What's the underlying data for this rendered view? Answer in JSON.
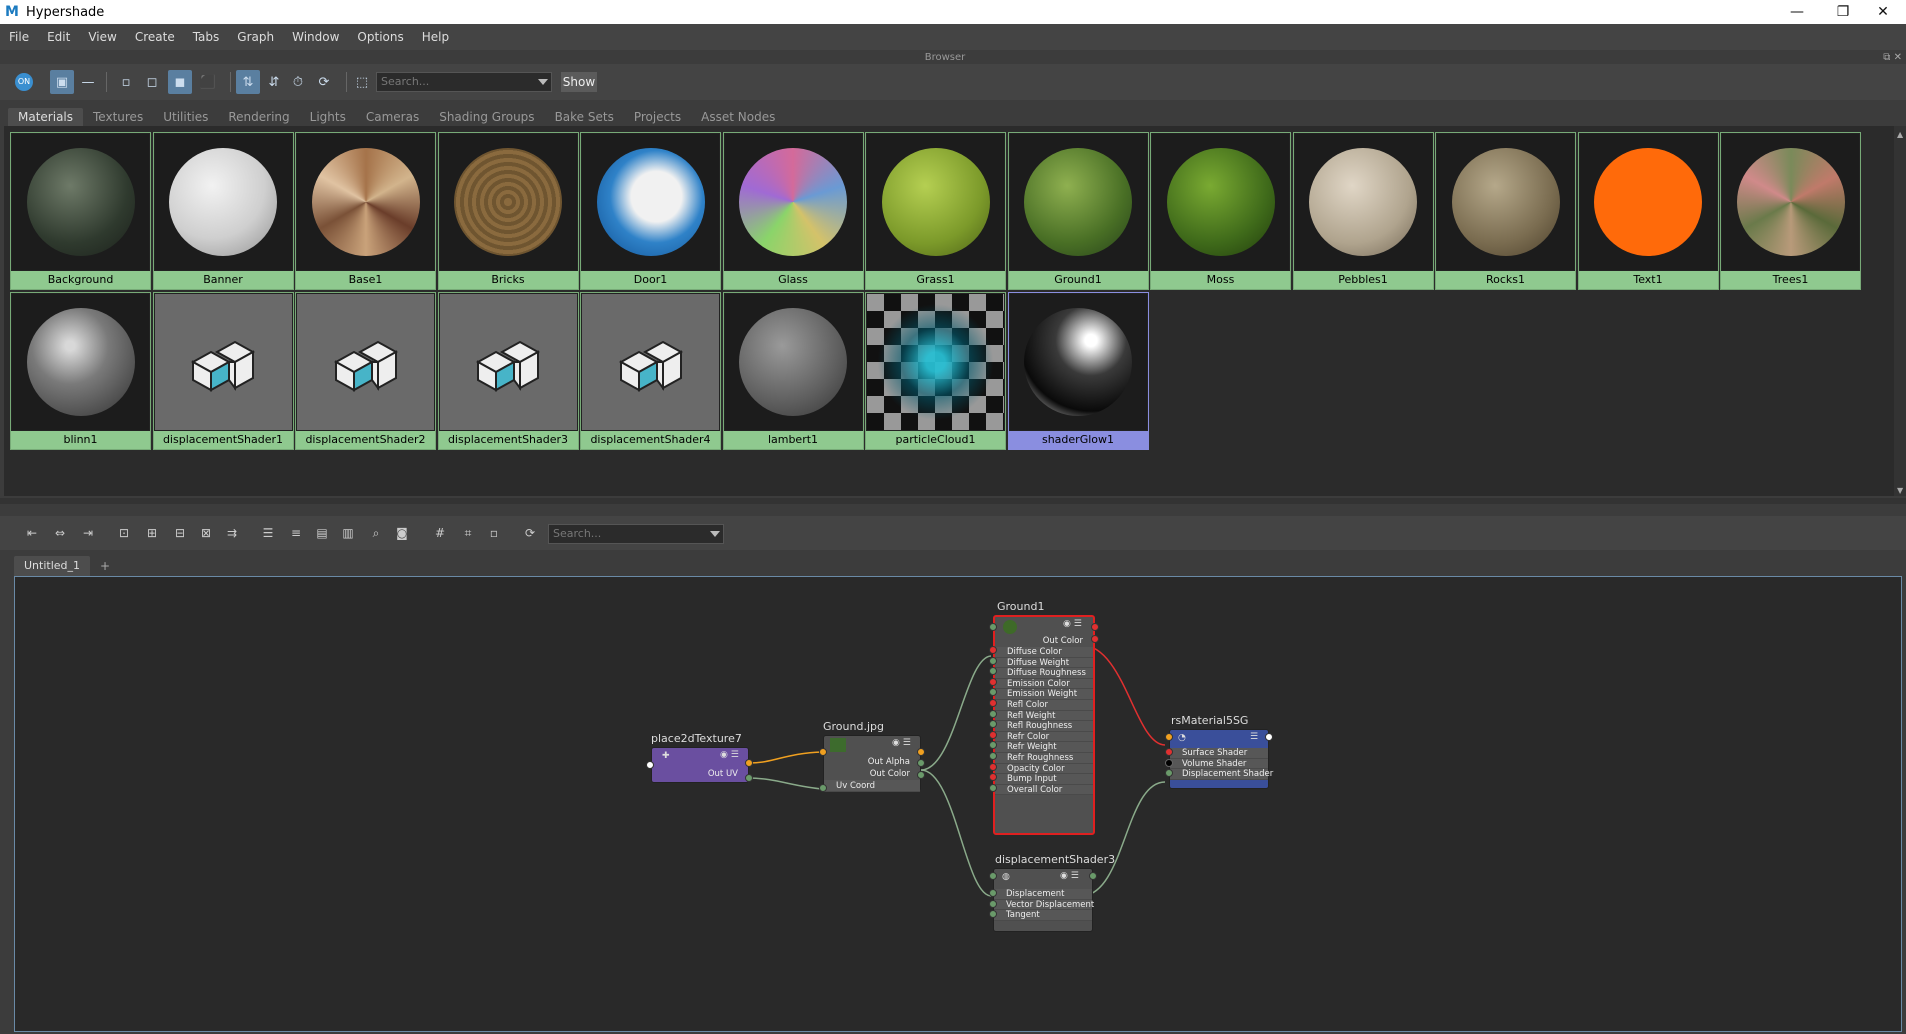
{
  "window": {
    "title": "Hypershade",
    "app_icon": "M",
    "minimize": "—",
    "restore": "❐",
    "close": "✕"
  },
  "menu": [
    "File",
    "Edit",
    "View",
    "Create",
    "Tabs",
    "Graph",
    "Window",
    "Options",
    "Help"
  ],
  "browser": {
    "label": "Browser",
    "search_placeholder": "Search...",
    "show_label": "Show",
    "tabs": [
      "Materials",
      "Textures",
      "Utilities",
      "Rendering",
      "Lights",
      "Cameras",
      "Shading Groups",
      "Bake Sets",
      "Projects",
      "Asset Nodes"
    ],
    "active_tab": "Materials",
    "materials": [
      {
        "name": "Background",
        "style": "rock-dark"
      },
      {
        "name": "Banner",
        "style": "white"
      },
      {
        "name": "Base1",
        "style": "wood-radial"
      },
      {
        "name": "Bricks",
        "style": "brick"
      },
      {
        "name": "Door1",
        "style": "blue-white"
      },
      {
        "name": "Glass",
        "style": "glass"
      },
      {
        "name": "Grass1",
        "style": "grass"
      },
      {
        "name": "Ground1",
        "style": "ground"
      },
      {
        "name": "Moss",
        "style": "moss"
      },
      {
        "name": "Pebbles1",
        "style": "pebbles"
      },
      {
        "name": "Rocks1",
        "style": "rocks"
      },
      {
        "name": "Text1",
        "style": "orange"
      },
      {
        "name": "Trees1",
        "style": "trees"
      },
      {
        "name": "blinn1",
        "style": "blinn"
      },
      {
        "name": "displacementShader1",
        "style": "disp"
      },
      {
        "name": "displacementShader2",
        "style": "disp"
      },
      {
        "name": "displacementShader3",
        "style": "disp"
      },
      {
        "name": "displacementShader4",
        "style": "disp"
      },
      {
        "name": "lambert1",
        "style": "lambert"
      },
      {
        "name": "particleCloud1",
        "style": "checker"
      },
      {
        "name": "shaderGlow1",
        "style": "glow",
        "selected": true
      }
    ]
  },
  "editor": {
    "search_placeholder": "Search...",
    "tab": "Untitled_1",
    "add_tab": "+",
    "nodes": {
      "place2d": {
        "title": "place2dTexture7",
        "out": "Out UV"
      },
      "groundjpg": {
        "title": "Ground.jpg",
        "outs": [
          "Out Alpha",
          "Out Color"
        ],
        "in": "Uv Coord"
      },
      "ground1": {
        "title": "Ground1",
        "out": "Out Color",
        "attrs": [
          "Diffuse Color",
          "Diffuse Weight",
          "Diffuse Roughness",
          "Emission Color",
          "Emission Weight",
          "Refl Color",
          "Refl Weight",
          "Refl Roughness",
          "Refr Color",
          "Refr Weight",
          "Refr Roughness",
          "Opacity Color",
          "Bump Input",
          "Overall Color"
        ]
      },
      "disp3": {
        "title": "displacementShader3",
        "attrs": [
          "Displacement",
          "Vector Displacement",
          "Tangent"
        ]
      },
      "sg": {
        "title": "rsMaterial5SG",
        "attrs": [
          "Surface Shader",
          "Volume Shader",
          "Displacement Shader"
        ]
      }
    }
  }
}
